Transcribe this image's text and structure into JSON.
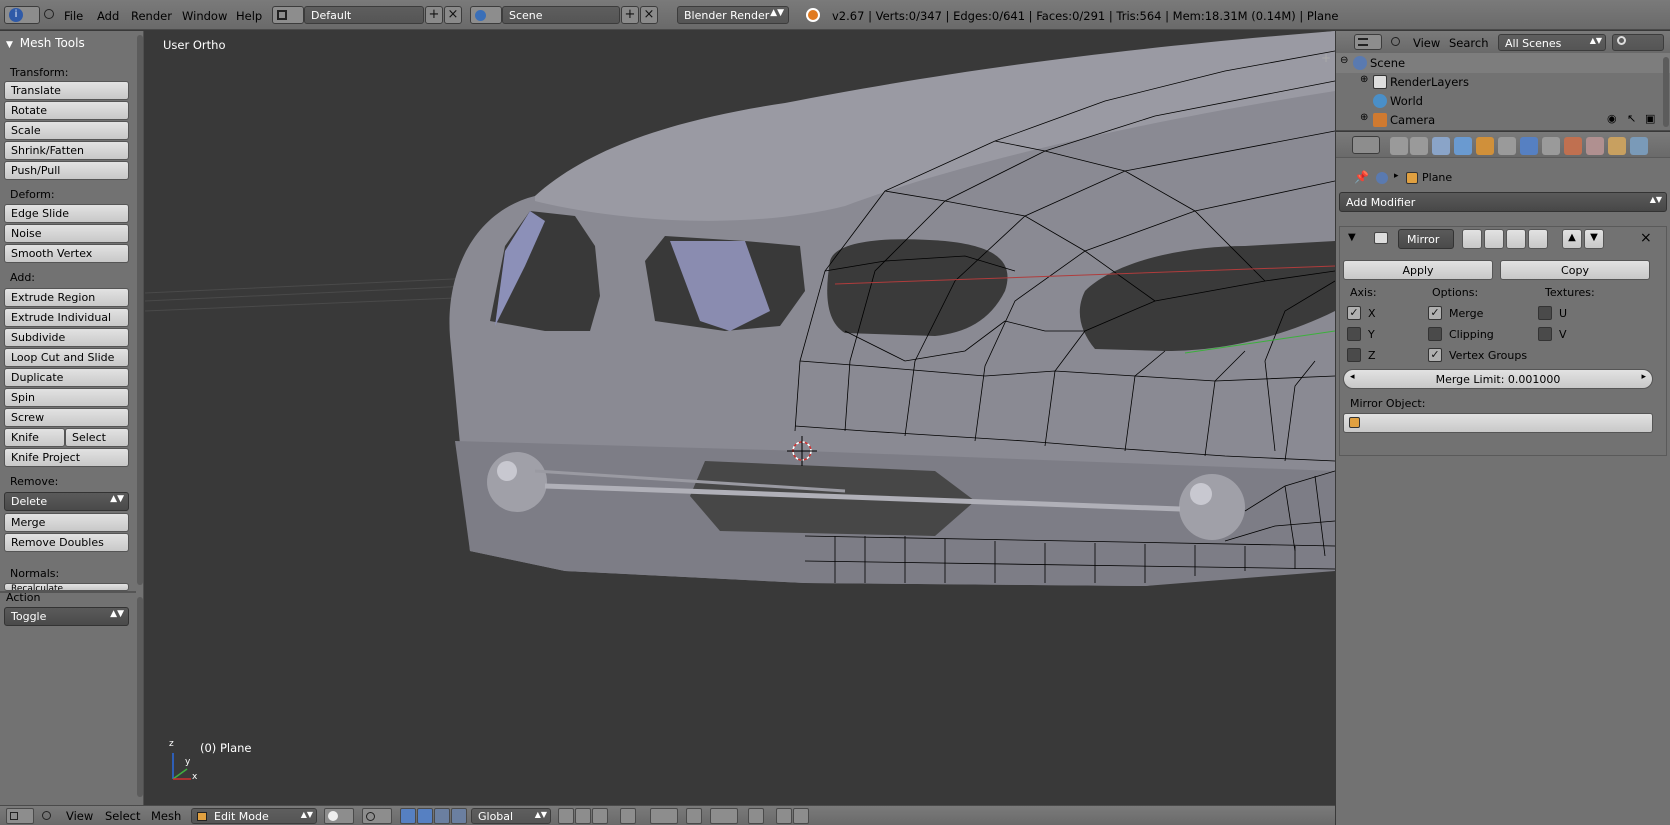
{
  "top_header": {
    "menus": [
      "File",
      "Add",
      "Render",
      "Window",
      "Help"
    ],
    "screen_layout": "Default",
    "scene": "Scene",
    "render_engine": "Blender Render",
    "stats": "v2.67 | Verts:0/347 | Edges:0/641 | Faces:0/291 | Tris:564 | Mem:18.31M (0.14M) | Plane"
  },
  "toolshelf": {
    "title": "Mesh Tools",
    "transform_label": "Transform:",
    "transform": [
      "Translate",
      "Rotate",
      "Scale",
      "Shrink/Fatten",
      "Push/Pull"
    ],
    "deform_label": "Deform:",
    "deform": [
      "Edge Slide",
      "Noise",
      "Smooth Vertex"
    ],
    "add_label": "Add:",
    "add": [
      "Extrude Region",
      "Extrude Individual",
      "Subdivide",
      "Loop Cut and Slide",
      "Duplicate",
      "Spin",
      "Screw"
    ],
    "knife": "Knife",
    "select": "Select",
    "knife_project": "Knife Project",
    "remove_label": "Remove:",
    "delete": "Delete",
    "merge": "Merge",
    "remove_doubles": "Remove Doubles",
    "normals_label": "Normals:",
    "recalculate": "Recalculate",
    "action_label": "Action",
    "action_value": "Toggle"
  },
  "viewport": {
    "view_name": "User Ortho",
    "object_info": "(0) Plane",
    "axis_z": "z",
    "axis_y": "y",
    "axis_x": "x"
  },
  "bottom_header": {
    "menus": [
      "View",
      "Select",
      "Mesh"
    ],
    "mode": "Edit Mode",
    "orientation": "Global"
  },
  "outliner": {
    "menus": [
      "View",
      "Search"
    ],
    "filter": "All Scenes",
    "items": [
      "Scene",
      "RenderLayers",
      "World",
      "Camera"
    ]
  },
  "properties": {
    "context_object": "Plane",
    "add_modifier": "Add Modifier",
    "modifier_name": "Mirror",
    "apply": "Apply",
    "copy": "Copy",
    "axis_label": "Axis:",
    "options_label": "Options:",
    "textures_label": "Textures:",
    "axis": [
      {
        "label": "X",
        "checked": true
      },
      {
        "label": "Y",
        "checked": false
      },
      {
        "label": "Z",
        "checked": false
      }
    ],
    "options": [
      {
        "label": "Merge",
        "checked": true
      },
      {
        "label": "Clipping",
        "checked": false
      },
      {
        "label": "Vertex Groups",
        "checked": true
      }
    ],
    "textures": [
      {
        "label": "U",
        "checked": false
      },
      {
        "label": "V",
        "checked": false
      }
    ],
    "merge_limit": "Merge Limit: 0.001000",
    "mirror_object_label": "Mirror Object:"
  },
  "colors": {
    "header_bg": "#727272",
    "viewport_bg": "#393939",
    "mesh_fill": "#8e8e97",
    "mesh_edge": "#000000",
    "accent_blue": "#5680c2"
  }
}
